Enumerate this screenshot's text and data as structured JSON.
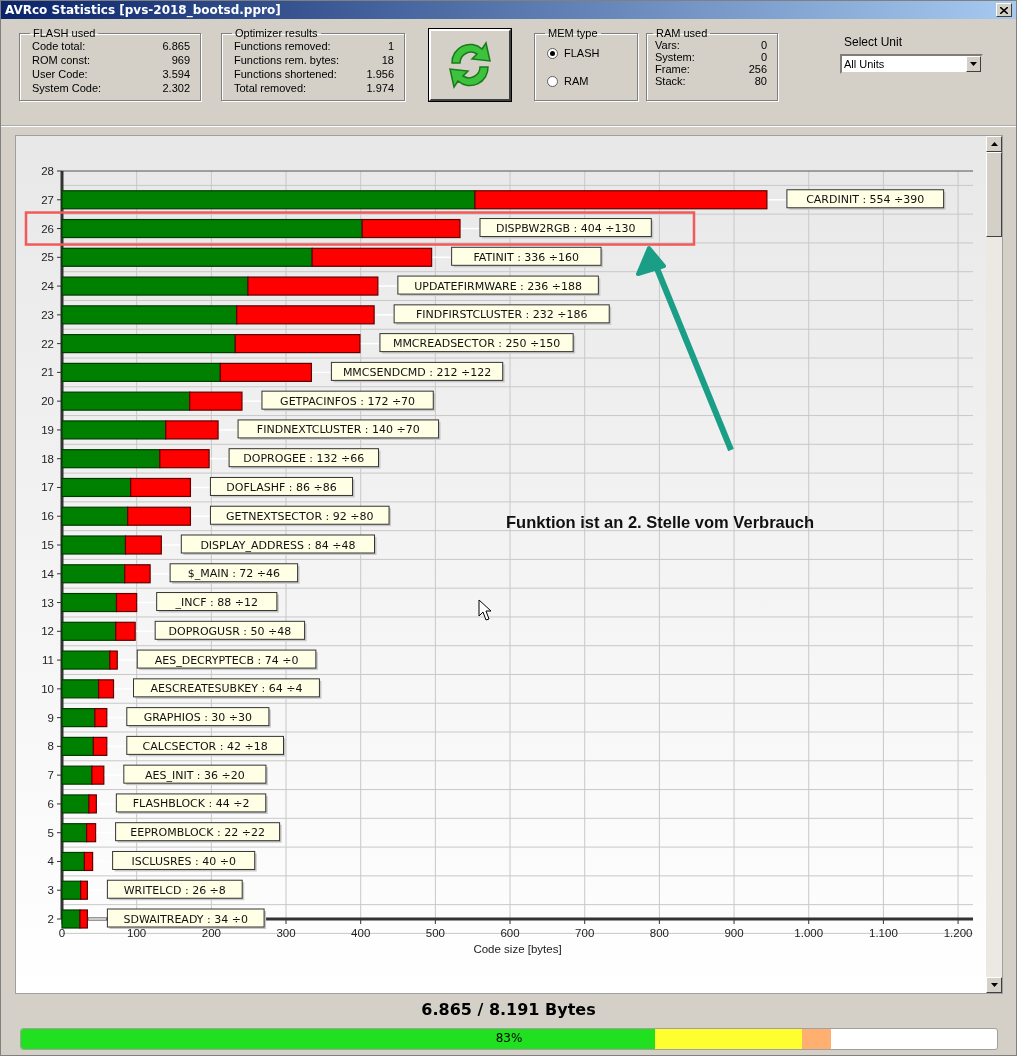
{
  "window": {
    "title": "AVRco Statistics [pvs-2018_bootsd.ppro]"
  },
  "flash_used": {
    "title": "FLASH used",
    "rows": [
      {
        "label": "Code total:",
        "value": "6.865"
      },
      {
        "label": "ROM const:",
        "value": "969"
      },
      {
        "label": "User Code:",
        "value": "3.594"
      },
      {
        "label": "System Code:",
        "value": "2.302"
      }
    ]
  },
  "optimizer_results": {
    "title": "Optimizer results",
    "rows": [
      {
        "label": "Functions removed:",
        "value": "1"
      },
      {
        "label": "Functions rem. bytes:",
        "value": "18"
      },
      {
        "label": "Functions shortened:",
        "value": "1.956"
      },
      {
        "label": "Total removed:",
        "value": "1.974"
      }
    ]
  },
  "mem_type": {
    "title": "MEM type",
    "options": [
      {
        "label": "FLASH",
        "selected": true
      },
      {
        "label": "RAM",
        "selected": false
      }
    ]
  },
  "ram_used": {
    "title": "RAM used",
    "rows": [
      {
        "label": "Vars:",
        "value": "0"
      },
      {
        "label": "System:",
        "value": "0"
      },
      {
        "label": "Frame:",
        "value": "256"
      },
      {
        "label": "Stack:",
        "value": "80"
      }
    ]
  },
  "select_unit": {
    "label": "Select Unit",
    "value": "All Units"
  },
  "chart": {
    "chart_data": {
      "type": "bar",
      "orientation": "horizontal",
      "stacked": true,
      "xlabel": "Code size [bytes]",
      "grid": true,
      "categories": [
        "28",
        "27",
        "26",
        "25",
        "24",
        "23",
        "22",
        "21",
        "20",
        "19",
        "18",
        "17",
        "16",
        "15",
        "14",
        "13",
        "12",
        "11",
        "10",
        "9",
        "8",
        "7",
        "6",
        "5",
        "4",
        "3",
        "2"
      ],
      "series": [
        {
          "color": "#008000",
          "values": [
            null,
            553,
            402,
            335,
            249,
            234,
            232,
            212,
            171,
            139,
            131,
            92,
            88,
            85,
            84,
            73,
            72,
            64,
            49,
            44,
            42,
            40,
            36,
            33,
            30,
            25,
            24
          ]
        },
        {
          "color": "#ff0000",
          "values": [
            null,
            391,
            131,
            160,
            174,
            184,
            167,
            122,
            70,
            70,
            66,
            80,
            84,
            48,
            34,
            27,
            26,
            10,
            20,
            16,
            18,
            16,
            10,
            12,
            11,
            9,
            10
          ]
        }
      ],
      "value_labels": [
        null,
        "CARDINIT : 554 ÷390",
        "DISPBW2RGB : 404 ÷130",
        "FATINIT : 336 ÷160",
        "UPDATEFIRMWARE : 236 ÷188",
        "FINDFIRSTCLUSTER : 232 ÷186",
        "MMCREADSECTOR : 250 ÷150",
        "MMCSENDCMD : 212 ÷122",
        "GETPACINFOS : 172 ÷70",
        "FINDNEXTCLUSTER : 140 ÷70",
        "DOPROGEE : 132 ÷66",
        "DOFLASHF : 86 ÷86",
        "GETNEXTSECTOR : 92 ÷80",
        "DISPLAY_ADDRESS : 84 ÷48",
        "$_MAIN : 72 ÷46",
        "_INCF : 88 ÷12",
        "DOPROGUSR : 50 ÷48",
        "AES_DECRYPTECB : 74 ÷0",
        "AESCREATESUBKEY : 64 ÷4",
        "GRAPHIOS : 30 ÷30",
        "CALCSECTOR : 42 ÷18",
        "AES_INIT : 36 ÷20",
        "FLASHBLOCK : 44 ÷2",
        "EEPROMBLOCK : 22 ÷22",
        "ISCLUSRES : 40 ÷0",
        "WRITELCD : 26 ÷8",
        "SDWAITREADY : 34 ÷0"
      ],
      "xlim": [
        0,
        1220
      ],
      "xticks": [
        {
          "value": 0,
          "label": "0"
        },
        {
          "value": 100,
          "label": "100"
        },
        {
          "value": 200,
          "label": "200"
        },
        {
          "value": 300,
          "label": "300"
        },
        {
          "value": 400,
          "label": "400"
        },
        {
          "value": 500,
          "label": "500"
        },
        {
          "value": 600,
          "label": "600"
        },
        {
          "value": 700,
          "label": "700"
        },
        {
          "value": 800,
          "label": "800"
        },
        {
          "value": 900,
          "label": "900"
        },
        {
          "value": 1000,
          "label": "1.000"
        },
        {
          "value": 1100,
          "label": "1.100"
        },
        {
          "value": 1200,
          "label": "1.200"
        }
      ],
      "annotations": [
        {
          "text": "Funktion ist an 2. Stelle vom Verbrauch"
        }
      ]
    },
    "row_highlighted": [
      false,
      false,
      true,
      false,
      false,
      false,
      false,
      false,
      false,
      false,
      false,
      false,
      false,
      false,
      false,
      false,
      false,
      false,
      false,
      false,
      false,
      false,
      false,
      false,
      false,
      false,
      false
    ]
  },
  "summary": "6.865 / 8.191 Bytes",
  "usage_bar": {
    "level": 0.83,
    "label": "83%"
  }
}
